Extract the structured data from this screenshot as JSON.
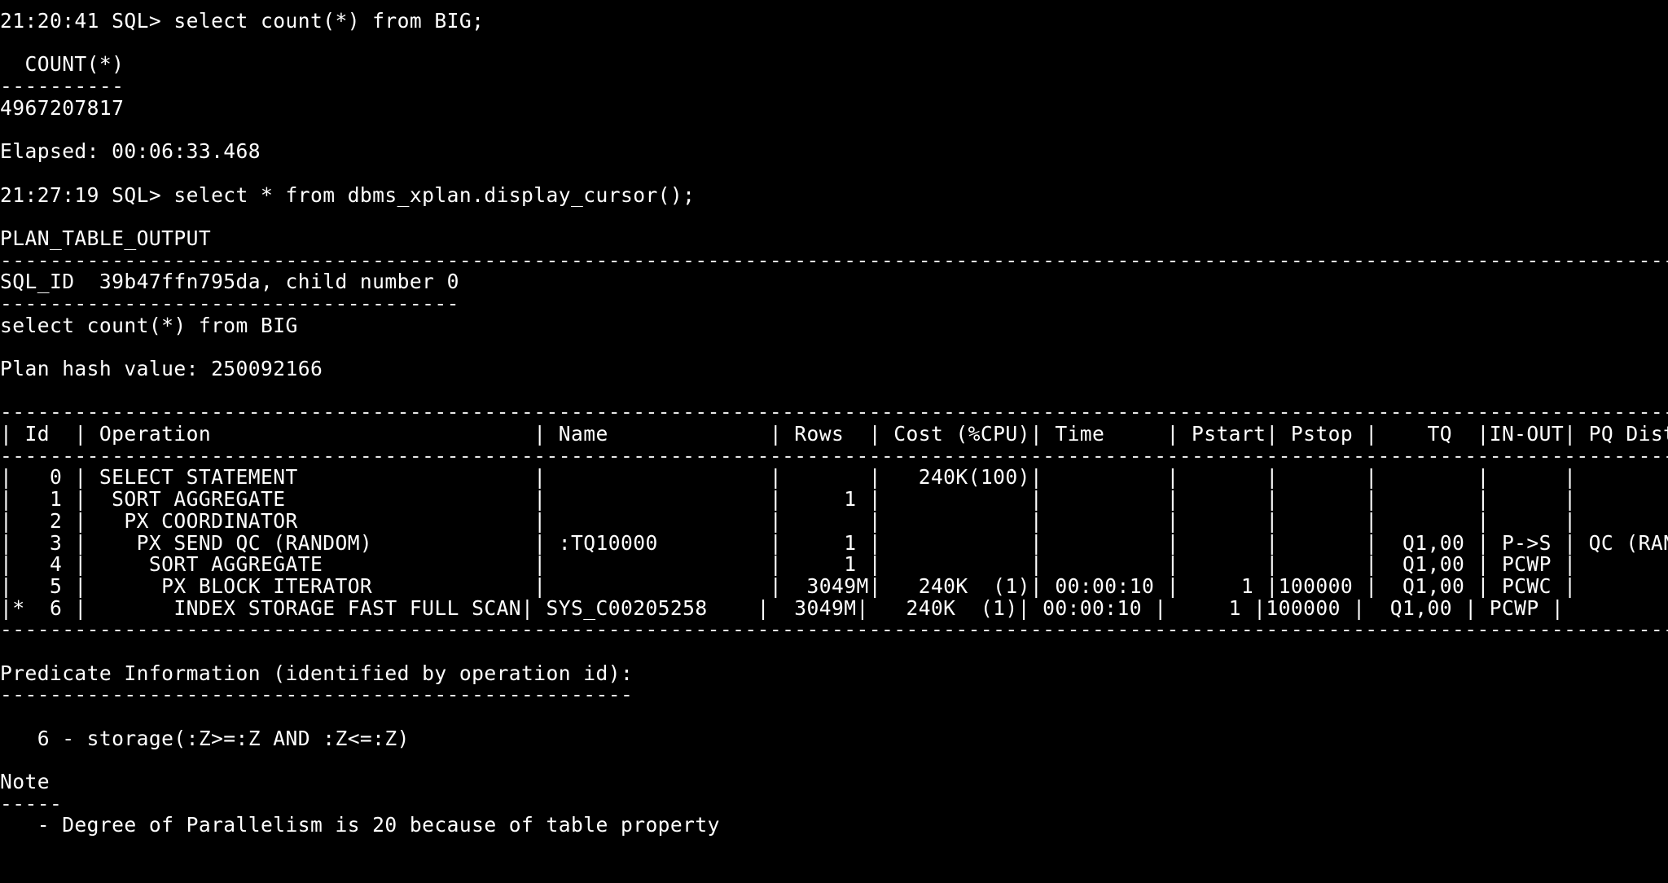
{
  "terminal": {
    "colors": {
      "background": "#000000",
      "foreground": "#ffffff"
    },
    "lines": [
      "21:20:41 SQL> select count(*) from BIG;",
      "",
      "  COUNT(*)",
      "----------",
      "4967207817",
      "",
      "Elapsed: 00:06:33.468",
      "",
      "21:27:19 SQL> select * from dbms_xplan.display_cursor();",
      "",
      "PLAN_TABLE_OUTPUT",
      "-------------------------------------------------------------------------------------------------------------------------------------------",
      "SQL_ID  39b47ffn795da, child number 0",
      "-------------------------------------",
      "select count(*) from BIG",
      "",
      "Plan hash value: 250092166",
      "",
      "-------------------------------------------------------------------------------------------------------------------------------------------",
      "| Id  | Operation                          | Name             | Rows  | Cost (%CPU)| Time     | Pstart| Pstop |    TQ  |IN-OUT| PQ Distrib |",
      "-------------------------------------------------------------------------------------------------------------------------------------------",
      "|   0 | SELECT STATEMENT                   |                  |       |   240K(100)|          |       |       |        |      |            |",
      "|   1 |  SORT AGGREGATE                    |                  |     1 |            |          |       |       |        |      |            |",
      "|   2 |   PX COORDINATOR                   |                  |       |            |          |       |       |        |      |            |",
      "|   3 |    PX SEND QC (RANDOM)             | :TQ10000         |     1 |            |          |       |       |  Q1,00 | P->S | QC (RAND)  |",
      "|   4 |     SORT AGGREGATE                 |                  |     1 |            |          |       |       |  Q1,00 | PCWP |            |",
      "|   5 |      PX BLOCK ITERATOR             |                  |  3049M|   240K  (1)| 00:00:10 |     1 |100000 |  Q1,00 | PCWC |            |",
      "|*  6 |       INDEX STORAGE FAST FULL SCAN| SYS_C00205258    |  3049M|   240K  (1)| 00:00:10 |     1 |100000 |  Q1,00 | PCWP |            |",
      "-------------------------------------------------------------------------------------------------------------------------------------------",
      "",
      "Predicate Information (identified by operation id):",
      "---------------------------------------------------",
      "",
      "   6 - storage(:Z>=:Z AND :Z<=:Z)",
      "",
      "Note",
      "-----",
      "   - Degree of Parallelism is 20 because of table property"
    ]
  }
}
